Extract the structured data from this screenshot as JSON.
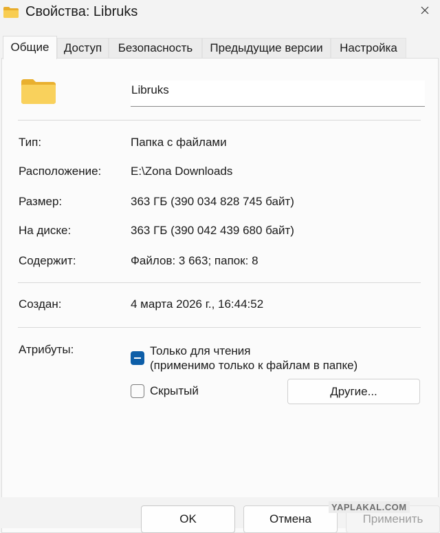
{
  "window": {
    "title": "Свойства: Libruks",
    "icons": {
      "title": "folder-icon",
      "close": "close-icon"
    }
  },
  "tabs": [
    {
      "label": "Общие",
      "active": true
    },
    {
      "label": "Доступ"
    },
    {
      "label": "Безопасность"
    },
    {
      "label": "Предыдущие версии"
    },
    {
      "label": "Настройка"
    }
  ],
  "general": {
    "folder_name": "Libruks",
    "folder_icon": "folder-icon",
    "type_label": "Тип:",
    "type_value": "Папка с файлами",
    "location_label": "Расположение:",
    "location_value": "E:\\Zona Downloads",
    "size_label": "Размер:",
    "size_value": "363 ГБ (390 034 828 745 байт)",
    "disk_label": "На диске:",
    "disk_value": "363 ГБ (390 042 439 680 байт)",
    "contains_label": "Содержит:",
    "contains_value": "Файлов: 3 663; папок: 8",
    "created_label": "Создан:",
    "created_value": "4 марта 2026 г., 16:44:52",
    "attributes_label": "Атрибуты:",
    "readonly_line1": "Только для чтения",
    "readonly_line2": "(применимо только к файлам в папке)",
    "readonly_state": "indeterminate",
    "hidden_label": "Скрытый",
    "hidden_checked": false,
    "other_button": "Другие..."
  },
  "footer": {
    "ok": "OK",
    "cancel": "Отмена",
    "apply": "Применить"
  },
  "watermark": "YAPLAKAL.COM",
  "colors": {
    "accent": "#0d5ea8",
    "folder": "#f4c542",
    "window_bg": "#f3f3f3",
    "panel_bg": "#fbfbfb"
  }
}
